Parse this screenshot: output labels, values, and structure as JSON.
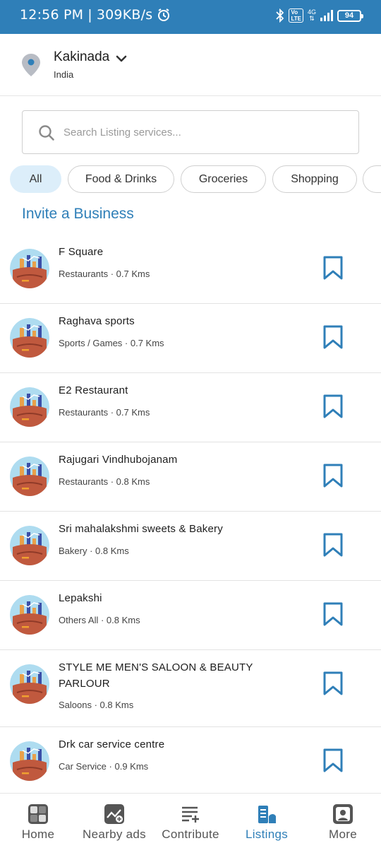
{
  "status_bar": {
    "time": "12:56 PM",
    "speed": "309KB/s",
    "network": "4G",
    "volte": "Vo LTE",
    "battery": "94"
  },
  "location": {
    "city": "Kakinada",
    "country": "India"
  },
  "search": {
    "placeholder": "Search Listing services..."
  },
  "categories": [
    {
      "label": "All",
      "active": true
    },
    {
      "label": "Food & Drinks",
      "active": false
    },
    {
      "label": "Groceries",
      "active": false
    },
    {
      "label": "Shopping",
      "active": false
    },
    {
      "label": "",
      "active": false
    }
  ],
  "invite_label": "Invite a Business",
  "listings": [
    {
      "name": "F Square",
      "category": "Restaurants",
      "distance": "0.7 Kms"
    },
    {
      "name": "Raghava sports",
      "category": "Sports / Games",
      "distance": "0.7 Kms"
    },
    {
      "name": "E2 Restaurant",
      "category": "Restaurants",
      "distance": "0.7 Kms"
    },
    {
      "name": "Rajugari Vindhubojanam",
      "category": "Restaurants",
      "distance": "0.8 Kms"
    },
    {
      "name": "Sri mahalakshmi sweets & Bakery",
      "category": "Bakery",
      "distance": "0.8 Kms"
    },
    {
      "name": "Lepakshi",
      "category": "Others All",
      "distance": "0.8 Kms"
    },
    {
      "name": "STYLE ME MEN'S SALOON & BEAUTY PARLOUR",
      "category": "Saloons",
      "distance": "0.8 Kms"
    },
    {
      "name": "Drk car service centre",
      "category": "Car Service",
      "distance": "0.9 Kms"
    }
  ],
  "bottom_nav": [
    {
      "label": "Home",
      "icon": "home-grid-icon",
      "active": false
    },
    {
      "label": "Nearby ads",
      "icon": "nearby-ads-icon",
      "active": false
    },
    {
      "label": "Contribute",
      "icon": "contribute-icon",
      "active": false
    },
    {
      "label": "Listings",
      "icon": "listings-icon",
      "active": true
    },
    {
      "label": "More",
      "icon": "more-icon",
      "active": false
    }
  ],
  "colors": {
    "accent": "#2f7fb8",
    "chip_active_bg": "#dceefa",
    "divider": "#e3e3e3"
  }
}
